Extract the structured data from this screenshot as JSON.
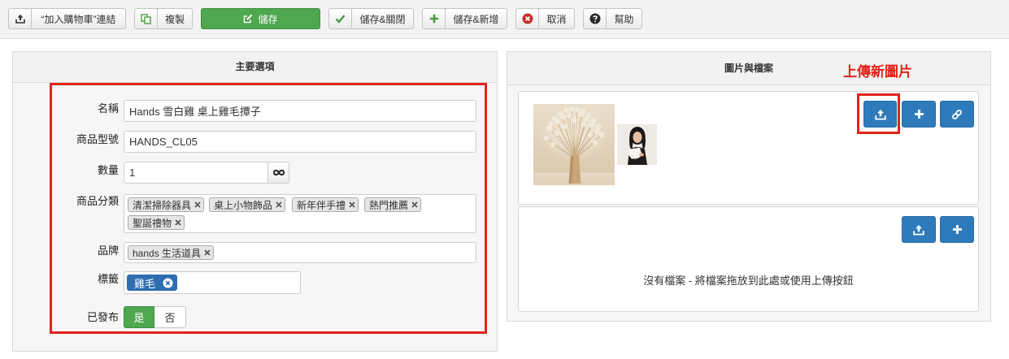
{
  "toolbar": {
    "add_to_cart_link": {
      "label": "“加入購物車”連結",
      "icon": "upload-icon"
    },
    "copy": {
      "label": "複製",
      "icon": "copy-icon"
    },
    "save": {
      "label": "儲存",
      "icon": "edit-icon"
    },
    "save_close": {
      "label": "儲存&關閉",
      "icon": "check-icon"
    },
    "save_new": {
      "label": "儲存&新增",
      "icon": "plus-icon"
    },
    "cancel": {
      "label": "取消",
      "icon": "cancel-icon"
    },
    "help": {
      "label": "幫助",
      "icon": "help-icon"
    }
  },
  "main_options": {
    "title": "主要選項",
    "name": {
      "label": "名稱",
      "value": "Hands 雪白雞 桌上雞毛撢子"
    },
    "product_code": {
      "label": "商品型號",
      "value": "HANDS_CL05"
    },
    "quantity": {
      "label": "數量",
      "value": "1",
      "unlimited_icon": "infinity-icon"
    },
    "categories": {
      "label": "商品分類",
      "items": [
        "清潔掃除器具",
        "桌上小物飾品",
        "新年伴手禮",
        "熱門推薦",
        "聖誕禮物"
      ],
      "remove_icon": "close-icon"
    },
    "brand": {
      "label": "品牌",
      "items": [
        "hands 生活道具"
      ],
      "remove_icon": "close-icon"
    },
    "tags": {
      "label": "標籤",
      "items": [
        "雞毛"
      ],
      "remove_icon": "circle-close-icon"
    },
    "published": {
      "label": "已發布",
      "options": [
        "是",
        "否"
      ],
      "selected": "是"
    }
  },
  "images_and_files": {
    "title": "圖片與檔案",
    "annotation": "上傳新圖片",
    "image_actions": [
      {
        "icon": "upload-icon"
      },
      {
        "icon": "plus-icon"
      },
      {
        "icon": "link-icon"
      }
    ],
    "file_actions": [
      {
        "icon": "upload-icon"
      },
      {
        "icon": "plus-icon"
      }
    ],
    "files_empty_text": "沒有檔案 - 將檔案拖放到此處或使用上傳按鈕"
  },
  "colors": {
    "save_green": "#4fa74f",
    "icon_green": "#4a9a3f",
    "primary_blue": "#2f7abb",
    "highlight_red": "#e2231a",
    "tag_blue": "#2e6db0",
    "cancel_red": "#c9302c"
  }
}
